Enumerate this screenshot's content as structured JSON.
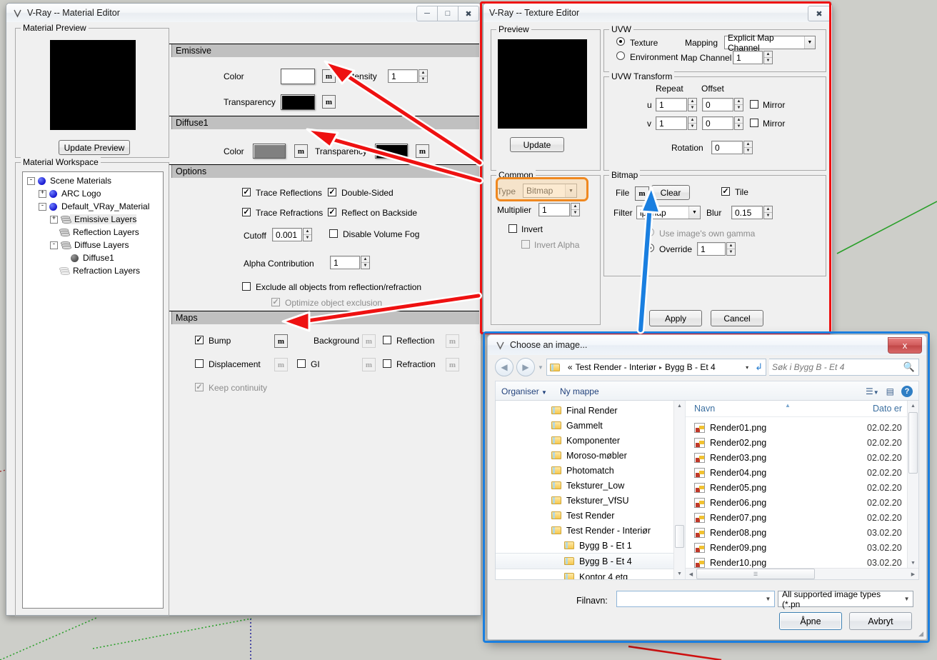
{
  "material_editor": {
    "title": "V-Ray -- Material Editor",
    "window_buttons": [
      "minimize",
      "maximize",
      "close"
    ],
    "material_preview": {
      "legend": "Material Preview",
      "update_button": "Update Preview",
      "preview_color": "#000000"
    },
    "material_workspace": {
      "legend": "Material Workspace",
      "tree": [
        {
          "label": "Scene Materials",
          "depth": 0,
          "toggle": "-",
          "icon": "blue-ball",
          "selected": false
        },
        {
          "label": "ARC Logo",
          "depth": 1,
          "toggle": "+",
          "icon": "blue-ball",
          "selected": false
        },
        {
          "label": "Default_VRay_Material",
          "depth": 1,
          "toggle": "-",
          "icon": "blue-ball",
          "selected": false
        },
        {
          "label": "Emissive Layers",
          "depth": 2,
          "toggle": "+",
          "icon": "layer-stack",
          "selected": true
        },
        {
          "label": "Reflection Layers",
          "depth": 2,
          "toggle": "",
          "icon": "layer-stack",
          "selected": false
        },
        {
          "label": "Diffuse Layers",
          "depth": 2,
          "toggle": "-",
          "icon": "layer-stack",
          "selected": false
        },
        {
          "label": "Diffuse1",
          "depth": 3,
          "toggle": "",
          "icon": "gray-ball",
          "selected": false
        },
        {
          "label": "Refraction Layers",
          "depth": 2,
          "toggle": "",
          "icon": "layer-stack-dim",
          "selected": false
        }
      ]
    },
    "sections": {
      "emissive": {
        "title": "Emissive",
        "color_label": "Color",
        "color_value": "#ffffff",
        "color_map_button": "m",
        "intensity_label": "Intensity",
        "intensity_value": "1",
        "transparency_label": "Transparency",
        "transparency_value": "#000000",
        "transparency_map_button": "m"
      },
      "diffuse1": {
        "title": "Diffuse1",
        "color_label": "Color",
        "color_value": "#808080",
        "color_map_button": "m",
        "transparency_label": "Transparency",
        "transparency_value": "#000000",
        "transparency_map_button": "m"
      },
      "options": {
        "title": "Options",
        "trace_reflections": {
          "label": "Trace Reflections",
          "checked": true,
          "disabled": false
        },
        "double_sided": {
          "label": "Double-Sided",
          "checked": true,
          "disabled": false
        },
        "trace_refractions": {
          "label": "Trace Refractions",
          "checked": true,
          "disabled": false
        },
        "reflect_on_backside": {
          "label": "Reflect on Backside",
          "checked": true,
          "disabled": false
        },
        "cutoff": {
          "label": "Cutoff",
          "value": "0.001"
        },
        "disable_volume_fog": {
          "label": "Disable Volume Fog",
          "checked": false,
          "disabled": false
        },
        "alpha_contribution": {
          "label": "Alpha Contribution",
          "value": "1"
        },
        "exclude_all": {
          "label": "Exclude all objects from reflection/refraction",
          "checked": false,
          "disabled": false
        },
        "optimize_exclusion": {
          "label": "Optimize object exclusion",
          "checked": true,
          "disabled": true
        }
      },
      "maps": {
        "title": "Maps",
        "rows": [
          {
            "label": "Bump",
            "checked": true,
            "disabled": false,
            "map_button": "m",
            "map_enabled": true
          },
          {
            "label": "Background",
            "checked": null,
            "disabled": true,
            "map_button": "m",
            "map_enabled": false
          },
          {
            "label": "Reflection",
            "checked": false,
            "disabled": false,
            "map_button": "m",
            "map_enabled": false
          },
          {
            "label": "Displacement",
            "checked": false,
            "disabled": false,
            "map_button": "m",
            "map_enabled": false
          },
          {
            "label": "GI",
            "checked": false,
            "disabled": false,
            "map_button": "m",
            "map_enabled": false
          },
          {
            "label": "Refraction",
            "checked": false,
            "disabled": false,
            "map_button": "m",
            "map_enabled": false
          }
        ],
        "keep_continuity": {
          "label": "Keep continuity",
          "checked": true,
          "disabled": true
        }
      }
    }
  },
  "texture_editor": {
    "title": "V-Ray -- Texture Editor",
    "close_button": "close",
    "preview": {
      "legend": "Preview",
      "preview_color": "#000000",
      "update_button": "Update"
    },
    "uvw": {
      "legend": "UVW",
      "texture_radio": {
        "label": "Texture",
        "selected": true
      },
      "environment_radio": {
        "label": "Environment",
        "selected": false
      },
      "mapping_label": "Mapping",
      "mapping_value": "Explicit Map Channel",
      "map_channel_label": "Map Channel",
      "map_channel_value": "1"
    },
    "uvw_transform": {
      "legend": "UVW Transform",
      "repeat_header": "Repeat",
      "offset_header": "Offset",
      "rows": [
        {
          "axis": "u",
          "repeat": "1",
          "offset": "0",
          "mirror_label": "Mirror",
          "mirror_checked": false
        },
        {
          "axis": "v",
          "repeat": "1",
          "offset": "0",
          "mirror_label": "Mirror",
          "mirror_checked": false
        }
      ],
      "rotation_label": "Rotation",
      "rotation_value": "0"
    },
    "common": {
      "legend": "Common",
      "type_label": "Type",
      "type_value": "Bitmap",
      "multiplier_label": "Multiplier",
      "multiplier_value": "1",
      "invert": {
        "label": "Invert",
        "checked": false,
        "disabled": false
      },
      "invert_alpha": {
        "label": "Invert Alpha",
        "checked": false,
        "disabled": true
      }
    },
    "bitmap": {
      "legend": "Bitmap",
      "file_label": "File",
      "file_map_button": "m",
      "clear_button": "Clear",
      "tile": {
        "label": "Tile",
        "checked": true
      },
      "filter_label": "Filter",
      "filter_value": "ip-map",
      "blur_label": "Blur",
      "blur_value": "0.15",
      "own_gamma_radio": {
        "label": "Use image's own gamma",
        "selected": false,
        "disabled": true
      },
      "override_radio": {
        "label": "Override",
        "selected": true,
        "disabled": false
      },
      "override_value": "1"
    },
    "apply_button": "Apply",
    "cancel_button": "Cancel"
  },
  "file_dialog": {
    "title": "Choose an image...",
    "close_button": "x",
    "breadcrumb": {
      "overflow": "«",
      "parts": [
        "Test Render - Interiør",
        "Bygg B - Et 4"
      ],
      "separator": "▸",
      "dropdown": "▾",
      "refresh": "refresh"
    },
    "search_placeholder": "Søk i Bygg B - Et 4",
    "toolbar": {
      "organize": "Organiser",
      "new_folder": "Ny mappe",
      "view_icon": "view-list-icon",
      "preview_pane_icon": "preview-pane-icon",
      "help_icon": "help-icon"
    },
    "folder_tree": [
      {
        "label": "Final Render",
        "indent": 0,
        "selected": false
      },
      {
        "label": "Gammelt",
        "indent": 0,
        "selected": false
      },
      {
        "label": "Komponenter",
        "indent": 0,
        "selected": false
      },
      {
        "label": "Moroso-møbler",
        "indent": 0,
        "selected": false
      },
      {
        "label": "Photomatch",
        "indent": 0,
        "selected": false
      },
      {
        "label": "Teksturer_Low",
        "indent": 0,
        "selected": false
      },
      {
        "label": "Teksturer_VfSU",
        "indent": 0,
        "selected": false
      },
      {
        "label": "Test Render",
        "indent": 0,
        "selected": false
      },
      {
        "label": "Test Render - Interiør",
        "indent": 0,
        "selected": false
      },
      {
        "label": "Bygg B - Et 1",
        "indent": 1,
        "selected": false
      },
      {
        "label": "Bygg B - Et 4",
        "indent": 1,
        "selected": true
      },
      {
        "label": "Kontor 4 etg",
        "indent": 1,
        "selected": false
      }
    ],
    "columns": [
      "Navn",
      "Dato er"
    ],
    "files": [
      {
        "name": "Render01.png",
        "date": "02.02.20"
      },
      {
        "name": "Render02.png",
        "date": "02.02.20"
      },
      {
        "name": "Render03.png",
        "date": "02.02.20"
      },
      {
        "name": "Render04.png",
        "date": "02.02.20"
      },
      {
        "name": "Render05.png",
        "date": "02.02.20"
      },
      {
        "name": "Render06.png",
        "date": "02.02.20"
      },
      {
        "name": "Render07.png",
        "date": "02.02.20"
      },
      {
        "name": "Render08.png",
        "date": "03.02.20"
      },
      {
        "name": "Render09.png",
        "date": "03.02.20"
      },
      {
        "name": "Render10.png",
        "date": "03.02.20"
      }
    ],
    "filename_label": "Filnavn:",
    "filename_value": "",
    "filetype_value": "All supported image types (*.pn",
    "open_button": "Åpne",
    "cancel_button": "Avbryt"
  },
  "annotations": {
    "highlight_color_red": "#ee1111",
    "highlight_color_orange": "#ef8820",
    "highlight_color_blue": "#1a7fe0"
  }
}
